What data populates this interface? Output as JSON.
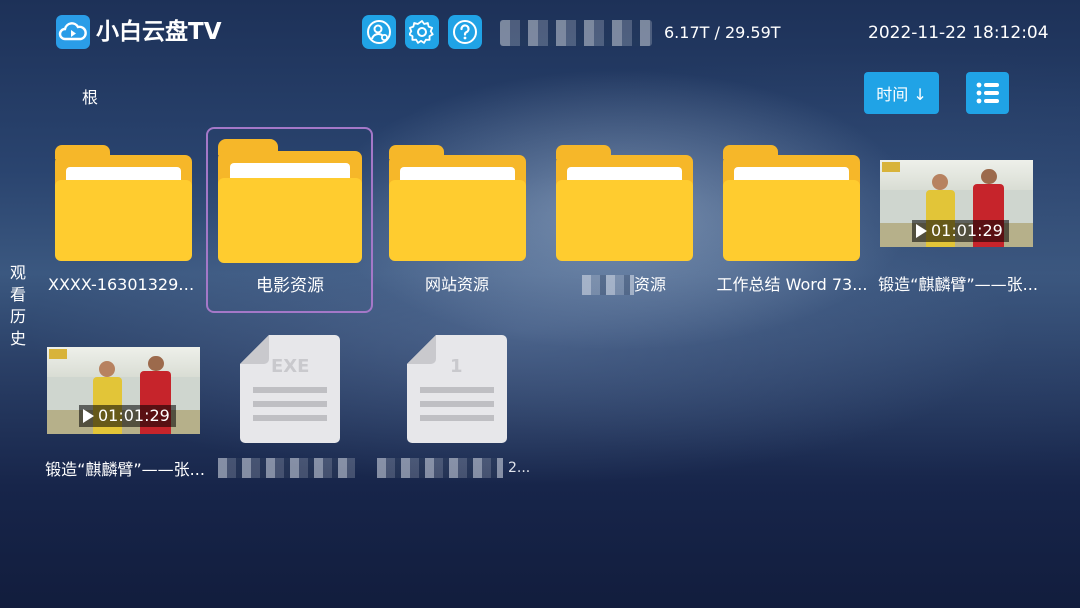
{
  "header": {
    "app_title": "小白云盘TV",
    "storage": "6.17T / 29.59T",
    "datetime": "2022-11-22 18:12:04",
    "icons": [
      "cloud-play-icon",
      "account-manage-icon",
      "settings-icon",
      "help-icon"
    ]
  },
  "toolbar": {
    "breadcrumb": "根",
    "sort_label": "时间 ↓",
    "view_icon": "list-view-icon"
  },
  "sidebar": {
    "history_label": "观看历史",
    "history_chars": [
      "观",
      "看",
      "历",
      "史"
    ]
  },
  "files": {
    "row1": [
      {
        "type": "folder",
        "label": "XXXX-1630132940"
      },
      {
        "type": "folder",
        "label": "电影资源",
        "focused": true
      },
      {
        "type": "folder",
        "label": "网站资源"
      },
      {
        "type": "folder",
        "label": "资源",
        "label_partially_blurred": true
      },
      {
        "type": "folder",
        "label": "工作总结 Word 73..."
      },
      {
        "type": "video",
        "label": "锻造“麒麟臂”——张...",
        "duration": "01:01:29"
      }
    ],
    "row2": [
      {
        "type": "video",
        "label": "锻造“麒麟臂”——张...",
        "duration": "01:01:29"
      },
      {
        "type": "file",
        "badge": "EXE",
        "label_blurred": true
      },
      {
        "type": "file",
        "badge": "1",
        "label_blurred": true,
        "label_suffix": "2..."
      }
    ]
  },
  "colors": {
    "accent": "#20a3e6",
    "folder_front": "#ffcc2f",
    "folder_back": "#f6b729",
    "focus_ring": "#a478c8"
  }
}
